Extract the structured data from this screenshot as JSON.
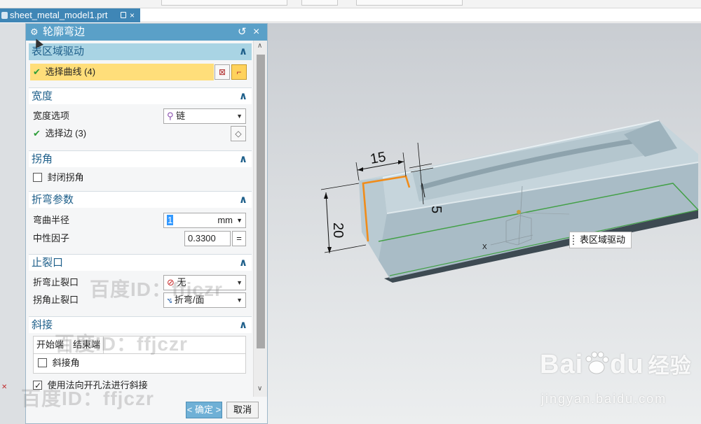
{
  "file_tab": {
    "name": "sheet_metal_model1.prt",
    "close": "×"
  },
  "dialog": {
    "title": "轮廓弯边",
    "reset_icon": "↺",
    "close_icon": "×",
    "sections": {
      "face_region": {
        "title": "表区域驱动",
        "select_curve": "选择曲线 (4)"
      },
      "width": {
        "title": "宽度",
        "option_label": "宽度选项",
        "option_value": "链",
        "select_edge": "选择边 (3)"
      },
      "corner": {
        "title": "拐角",
        "closed_corner": "封闭拐角",
        "closed_corner_checked": false
      },
      "bend_params": {
        "title": "折弯参数",
        "radius_label": "弯曲半径",
        "radius_value": "1",
        "radius_unit": "mm",
        "neutral_label": "中性因子",
        "neutral_value": "0.3300",
        "eq": "="
      },
      "relief": {
        "title": "止裂口",
        "bend_relief_label": "折弯止裂口",
        "bend_relief_value": "无",
        "corner_relief_label": "拐角止裂口",
        "corner_relief_value": "折弯/面"
      },
      "miter": {
        "title": "斜接",
        "tab_start": "开始端",
        "tab_end": "结束端",
        "miter_corner": "斜接角",
        "miter_corner_checked": false,
        "use_normal": "使用法向开孔法进行斜接",
        "use_normal_checked": true
      }
    },
    "ok": "< 确定 >",
    "cancel": "取消"
  },
  "viewport": {
    "callout": "表区域驱动",
    "dims": {
      "top": "15",
      "side": "5",
      "left": "20"
    },
    "axis_label": "X"
  },
  "watermarks": {
    "w1": "百度ID：ffjczr",
    "w2": "百度ID：ffjczr",
    "w3": "百度ID：ffjczr",
    "baidu_brand": "Bai",
    "baidu_brand2": "du",
    "baidu_cn": "经验",
    "baidu_url": "jingyan.baidu.com"
  },
  "colors": {
    "title_bar": "#5aa0c8",
    "section_text": "#1e5f8a",
    "selected_row": "#ffde7a",
    "model_face": "#aebfc8"
  }
}
